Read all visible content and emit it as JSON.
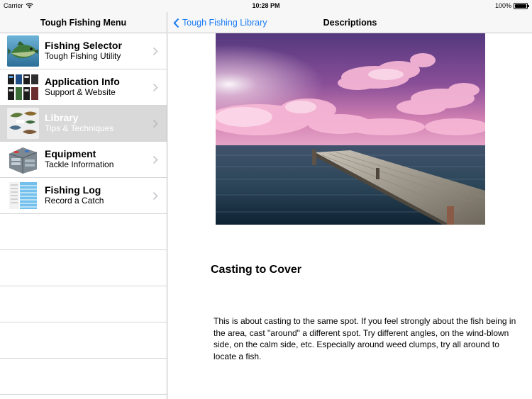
{
  "status_bar": {
    "carrier": "Carrier",
    "time": "10:28 PM",
    "battery": "100%",
    "battery_level": 1.0
  },
  "master": {
    "title": "Tough Fishing Menu",
    "items": [
      {
        "title": "Fishing Selector",
        "subtitle": "Tough Fishing Utility",
        "icon": "bass-fish-icon",
        "selected": false
      },
      {
        "title": "Application Info",
        "subtitle": "Support & Website",
        "icon": "app-screens-icon",
        "selected": false
      },
      {
        "title": "Library",
        "subtitle": "Tips & Techniques",
        "icon": "fish-tips-icon",
        "selected": true
      },
      {
        "title": "Equipment",
        "subtitle": "Tackle Information",
        "icon": "tackle-box-icon",
        "selected": false
      },
      {
        "title": "Fishing Log",
        "subtitle": "Record a Catch",
        "icon": "log-table-icon",
        "selected": false
      }
    ]
  },
  "detail": {
    "back_label": "Tough Fishing Library",
    "title": "Descriptions",
    "image_icon": "dock-sunset-photo",
    "article_title": "Casting to Cover",
    "article_body": "This is about casting to the same spot. If you feel strongly about the fish being in the area, cast \"around\" a different spot. Try different angles, on the wind-blown side, on the calm side, etc. Especially around weed clumps, try all around to locate a fish."
  },
  "colors": {
    "accent": "#1a7cf5",
    "selected_row": "#d9d9d9",
    "nav_bg": "#f7f7f7",
    "separator": "#d6d6da"
  }
}
